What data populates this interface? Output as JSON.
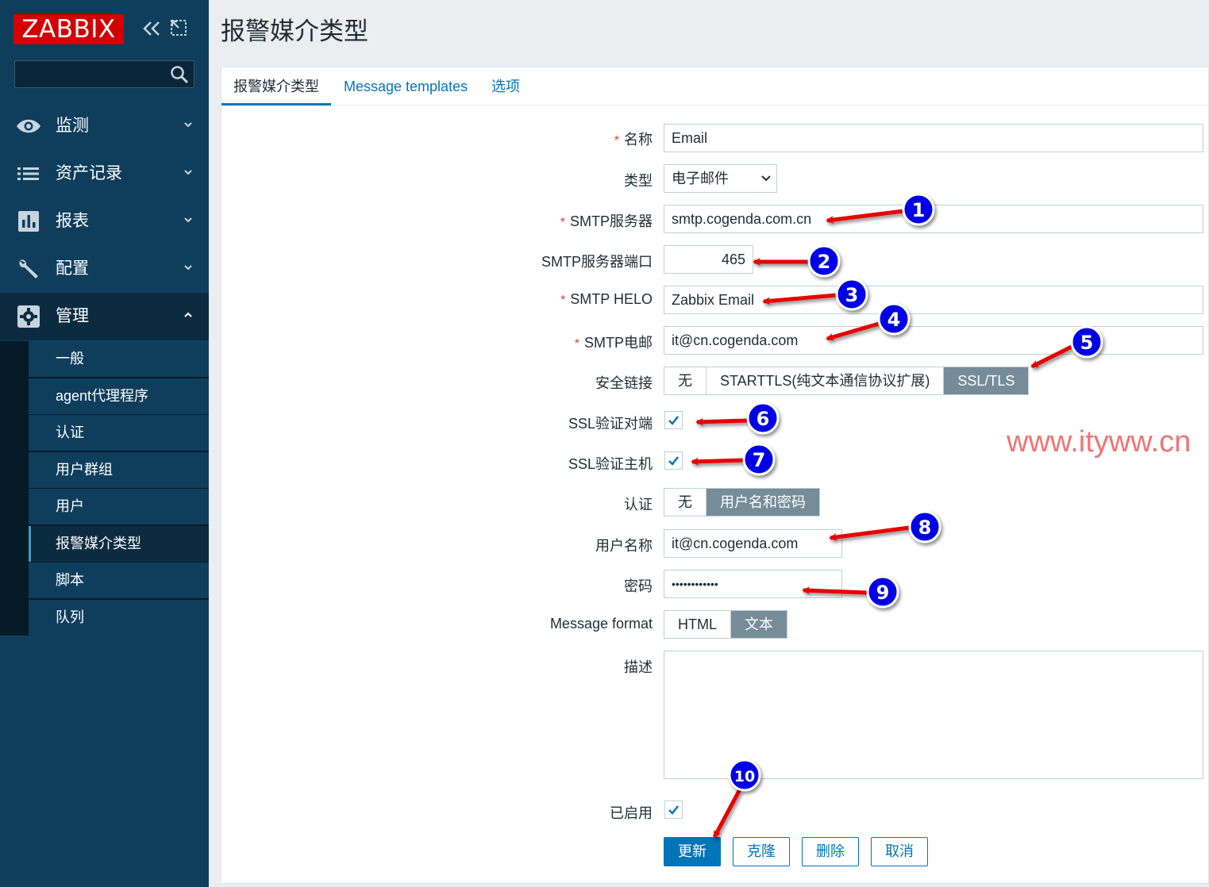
{
  "app": {
    "logo": "ZABBIX"
  },
  "sidebar": {
    "search_placeholder": "",
    "menu": [
      {
        "label": "监测",
        "icon": "eye-icon"
      },
      {
        "label": "资产记录",
        "icon": "list-icon"
      },
      {
        "label": "报表",
        "icon": "bar-chart-icon"
      },
      {
        "label": "配置",
        "icon": "wrench-icon"
      },
      {
        "label": "管理",
        "icon": "gear-icon",
        "expanded": true
      }
    ],
    "submenu": [
      {
        "label": "一般"
      },
      {
        "label": "agent代理程序"
      },
      {
        "label": "认证"
      },
      {
        "label": "用户群组"
      },
      {
        "label": "用户"
      },
      {
        "label": "报警媒介类型",
        "active": true
      },
      {
        "label": "脚本"
      },
      {
        "label": "队列"
      }
    ]
  },
  "page": {
    "title": "报警媒介类型"
  },
  "tabs": [
    {
      "label": "报警媒介类型",
      "active": true
    },
    {
      "label": "Message templates"
    },
    {
      "label": "选项"
    }
  ],
  "form": {
    "name": {
      "label": "名称",
      "required": true,
      "value": "Email"
    },
    "type": {
      "label": "类型",
      "value": "电子邮件"
    },
    "smtp_server": {
      "label": "SMTP服务器",
      "required": true,
      "value": "smtp.cogenda.com.cn"
    },
    "smtp_port": {
      "label": "SMTP服务器端口",
      "value": "465"
    },
    "smtp_helo": {
      "label": "SMTP HELO",
      "required": true,
      "value": "Zabbix Email"
    },
    "smtp_email": {
      "label": "SMTP电邮",
      "required": true,
      "value": "it@cn.cogenda.com"
    },
    "security": {
      "label": "安全链接",
      "options": [
        "无",
        "STARTTLS(纯文本通信协议扩展)",
        "SSL/TLS"
      ],
      "selected": "SSL/TLS"
    },
    "ssl_verify_peer": {
      "label": "SSL验证对端",
      "checked": true
    },
    "ssl_verify_host": {
      "label": "SSL验证主机",
      "checked": true
    },
    "auth": {
      "label": "认证",
      "options": [
        "无",
        "用户名和密码"
      ],
      "selected": "用户名和密码"
    },
    "username": {
      "label": "用户名称",
      "value": "it@cn.cogenda.com"
    },
    "password": {
      "label": "密码",
      "value": "••••••••••••"
    },
    "message_format": {
      "label": "Message format",
      "options": [
        "HTML",
        "文本"
      ],
      "selected": "文本"
    },
    "description": {
      "label": "描述",
      "value": ""
    },
    "enabled": {
      "label": "已启用",
      "checked": true
    }
  },
  "buttons": {
    "update": "更新",
    "clone": "克隆",
    "delete": "删除",
    "cancel": "取消"
  },
  "watermark": "www.ityww.cn",
  "annotations": [
    "1",
    "2",
    "3",
    "4",
    "5",
    "6",
    "7",
    "8",
    "9",
    "10"
  ],
  "colors": {
    "sidebar": "#0e3e5c",
    "accent": "#0275b8",
    "selected_segment": "#768d99",
    "logo": "#d40000",
    "annotation_badge": "#0000e6",
    "annotation_arrow": "#e60000"
  }
}
